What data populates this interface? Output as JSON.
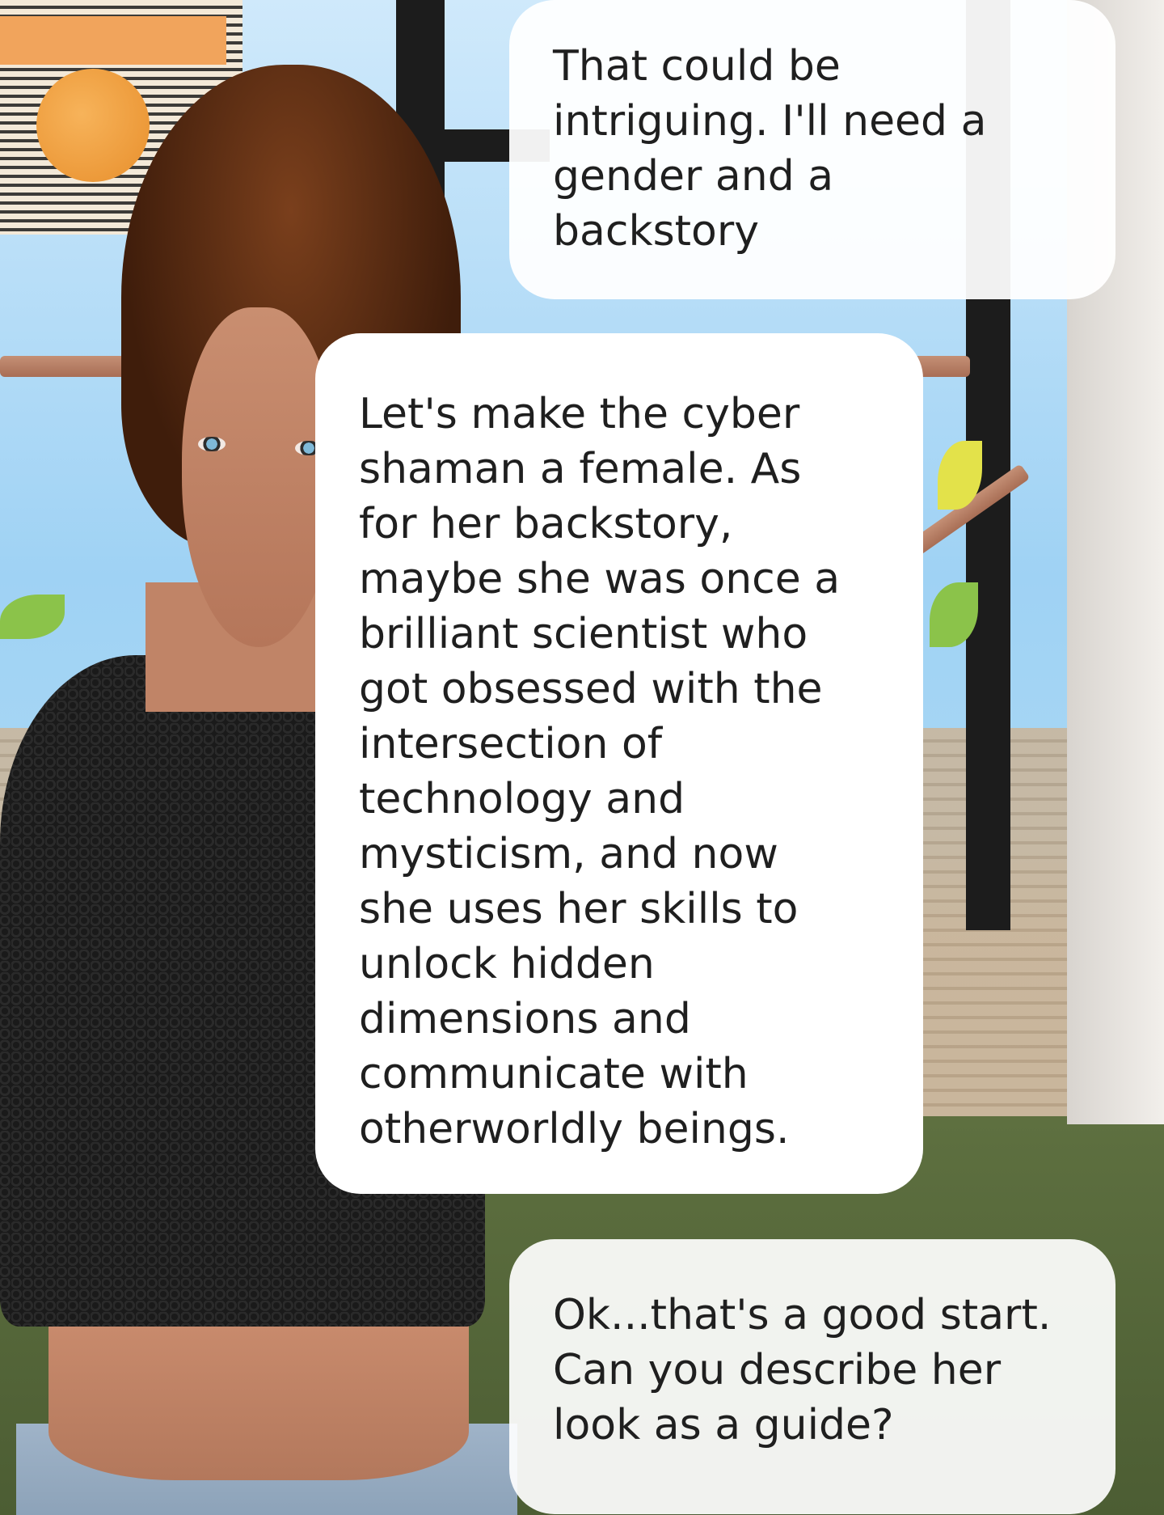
{
  "chat": {
    "messages": [
      {
        "side": "right",
        "text": "That could be\nintriguing.   I'll need a\ngender and a\nbackstory"
      },
      {
        "side": "left",
        "text": "Let's make the cyber\nshaman a female. As\nfor her backstory,\nmaybe she was once a\nbrilliant scientist who\ngot obsessed with the\nintersection of\ntechnology and\nmysticism, and now\nshe uses her skills to\nunlock hidden\ndimensions and\ncommunicate with\notherworldly beings."
      },
      {
        "side": "right",
        "text": "Ok...that's a good start.\nCan you describe her\nlook as a guide?"
      }
    ]
  },
  "colors": {
    "bubble_background": "#ffffff",
    "bubble_text": "#1f1f1f"
  }
}
